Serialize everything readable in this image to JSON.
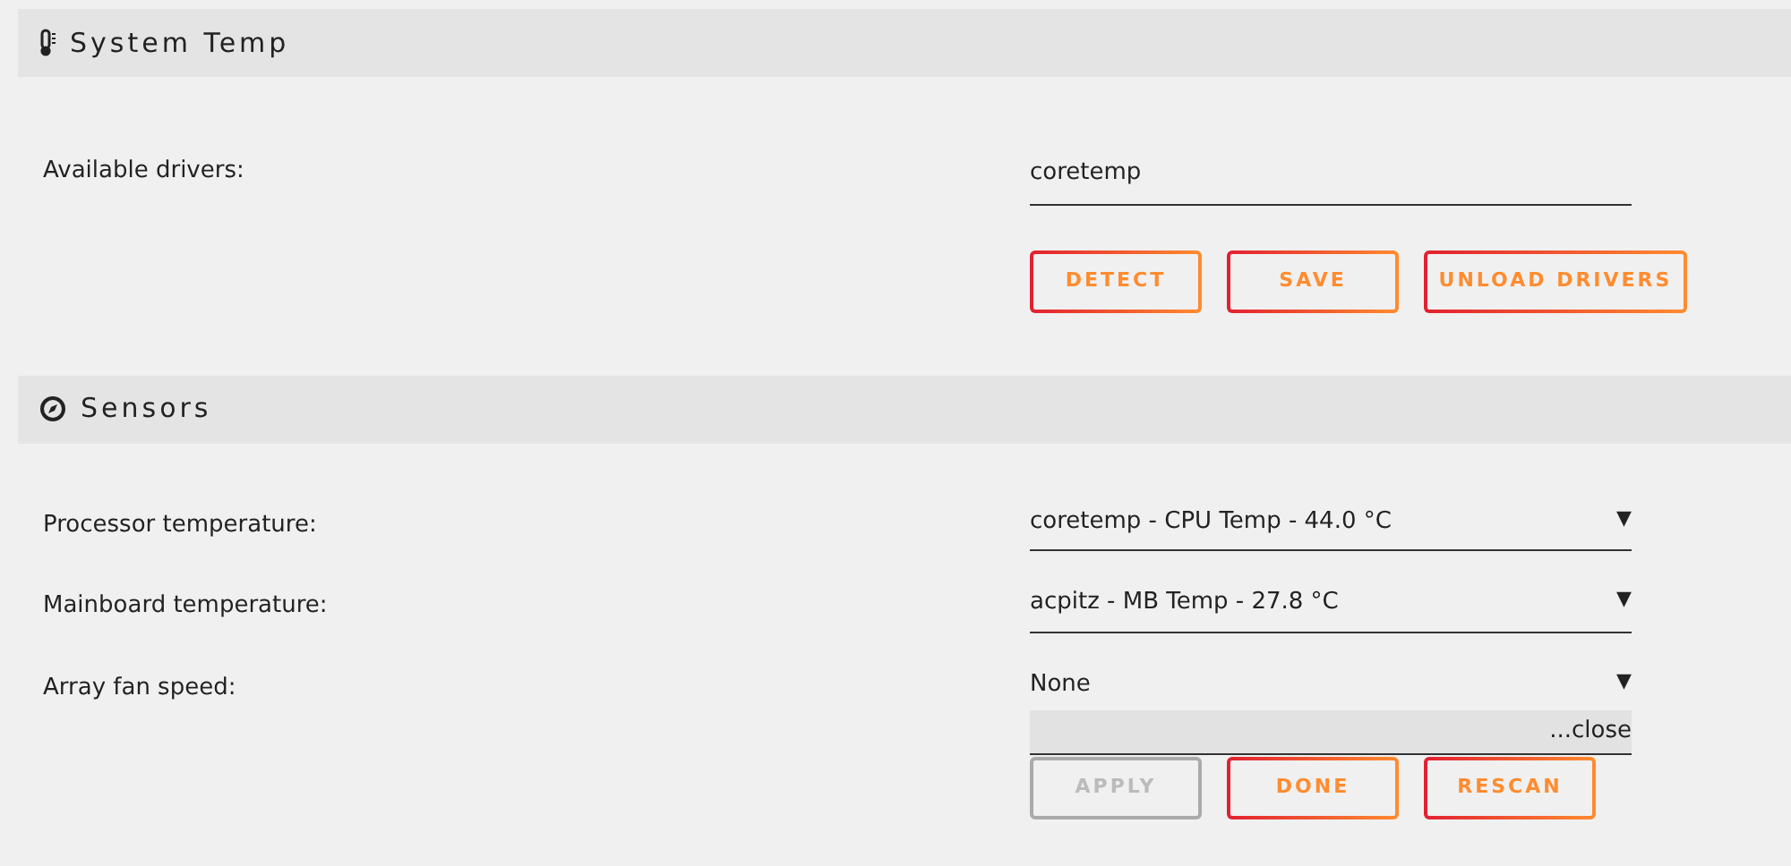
{
  "system_temp": {
    "title": "System Temp",
    "label": "Available drivers:",
    "value": "coretemp",
    "buttons": [
      {
        "label": "DETECT",
        "disabled": false
      },
      {
        "label": "SAVE",
        "disabled": false
      },
      {
        "label": "UNLOAD DRIVERS",
        "disabled": false
      }
    ]
  },
  "sensors": {
    "title": "Sensors",
    "rows": [
      {
        "label": "Processor temperature:",
        "value": "coretemp - CPU Temp - 44.0 °C",
        "arrow": "▼"
      },
      {
        "label": "Mainboard temperature:",
        "value": "acpitz - MB Temp - 27.8 °C",
        "arrow": "▼"
      },
      {
        "label": "Array fan speed:",
        "value": "None",
        "arrow": "▼"
      }
    ],
    "close": "...close",
    "buttons": [
      {
        "label": "APPLY",
        "disabled": true
      },
      {
        "label": "DONE",
        "disabled": false
      },
      {
        "label": "RESCAN",
        "disabled": false
      }
    ]
  }
}
